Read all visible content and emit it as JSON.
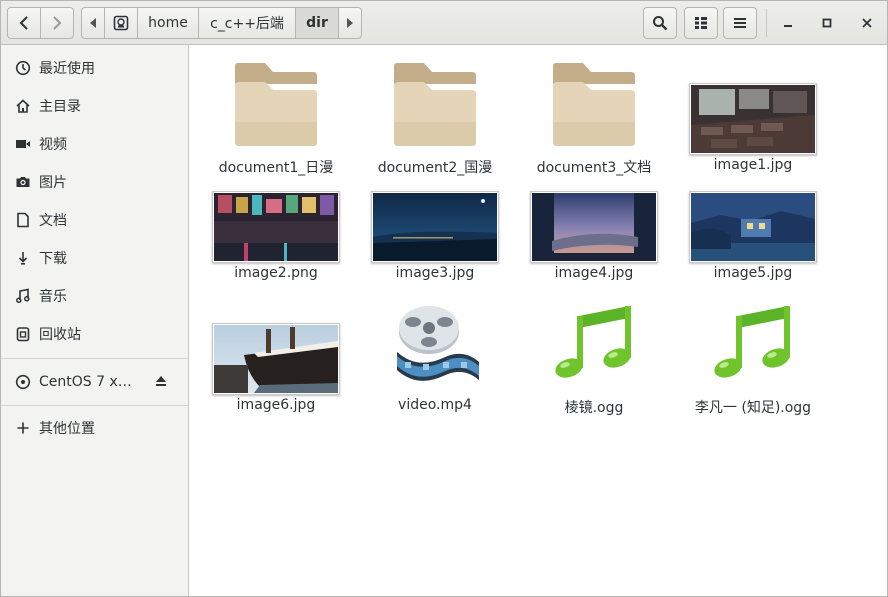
{
  "header": {
    "path": [
      "home",
      "c_c++后端",
      "dir"
    ]
  },
  "sidebar": {
    "items": [
      {
        "label": "最近使用",
        "icon": "recent-icon"
      },
      {
        "label": "主目录",
        "icon": "home-icon"
      },
      {
        "label": "视频",
        "icon": "video-icon"
      },
      {
        "label": "图片",
        "icon": "camera-icon"
      },
      {
        "label": "文档",
        "icon": "document-icon"
      },
      {
        "label": "下载",
        "icon": "download-icon"
      },
      {
        "label": "音乐",
        "icon": "music-icon"
      },
      {
        "label": "回收站",
        "icon": "trash-icon"
      }
    ],
    "devices": [
      {
        "label": "CentOS 7 x…",
        "icon": "disc-icon"
      }
    ],
    "other": {
      "label": "其他位置",
      "icon": "plus-icon"
    }
  },
  "files": [
    {
      "name": "document1_日漫",
      "type": "folder"
    },
    {
      "name": "document2_国漫",
      "type": "folder"
    },
    {
      "name": "document3_文档",
      "type": "folder"
    },
    {
      "name": "image1.jpg",
      "type": "image"
    },
    {
      "name": "image2.png",
      "type": "image"
    },
    {
      "name": "image3.jpg",
      "type": "image"
    },
    {
      "name": "image4.jpg",
      "type": "image"
    },
    {
      "name": "image5.jpg",
      "type": "image"
    },
    {
      "name": "image6.jpg",
      "type": "image"
    },
    {
      "name": "video.mp4",
      "type": "video"
    },
    {
      "name": "棱镜.ogg",
      "type": "audio"
    },
    {
      "name": "李凡一 (知足).ogg",
      "type": "audio"
    }
  ],
  "colors": {
    "folder": "#d9c7a3",
    "music_green": "#6fc42b",
    "header_bg": "#e8e8e6",
    "sidebar_bg": "#f3f3f2"
  }
}
